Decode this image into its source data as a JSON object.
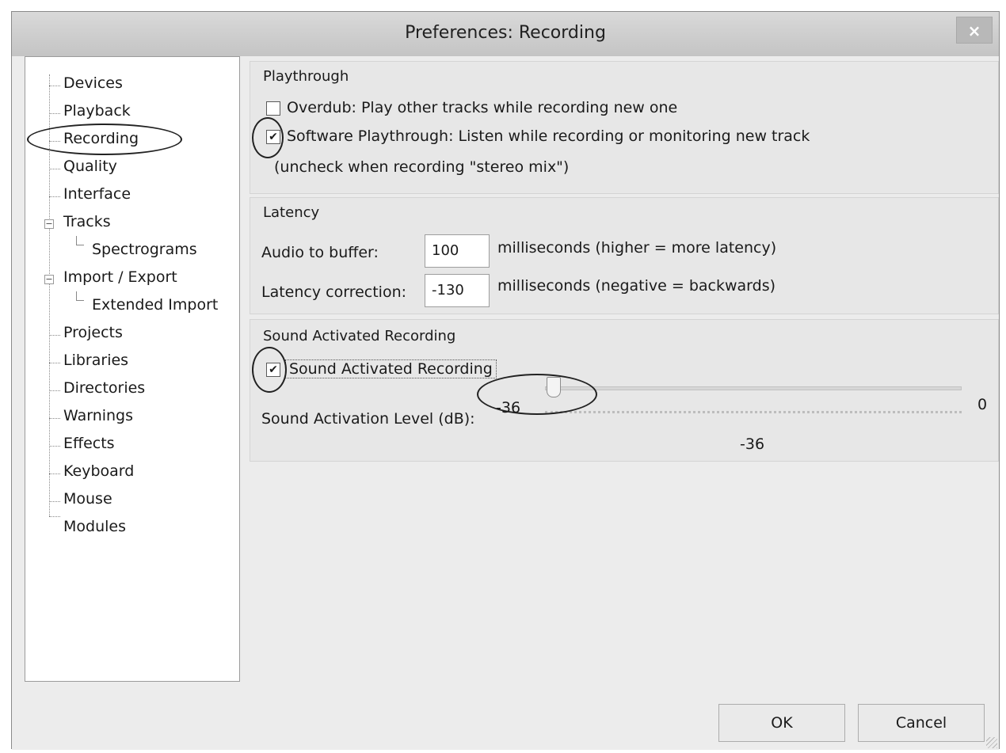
{
  "window": {
    "title": "Preferences: Recording",
    "close_glyph": "×"
  },
  "tree": {
    "items": [
      {
        "label": "Devices"
      },
      {
        "label": "Playback"
      },
      {
        "label": "Recording",
        "selected": true
      },
      {
        "label": "Quality"
      },
      {
        "label": "Interface"
      },
      {
        "label": "Tracks",
        "expandable": true
      },
      {
        "label": "Spectrograms",
        "child": true
      },
      {
        "label": "Import / Export",
        "expandable": true
      },
      {
        "label": "Extended Import",
        "child": true
      },
      {
        "label": "Projects"
      },
      {
        "label": "Libraries"
      },
      {
        "label": "Directories"
      },
      {
        "label": "Warnings"
      },
      {
        "label": "Effects"
      },
      {
        "label": "Keyboard"
      },
      {
        "label": "Mouse"
      },
      {
        "label": "Modules"
      }
    ]
  },
  "playthrough": {
    "title": "Playthrough",
    "overdub": {
      "label": "Overdub: Play other tracks while recording new one",
      "checked": false
    },
    "software": {
      "label": "Software Playthrough: Listen while recording or monitoring new track",
      "checked": true
    },
    "note": "(uncheck when recording \"stereo mix\")"
  },
  "latency": {
    "title": "Latency",
    "buffer": {
      "label": "Audio to buffer:",
      "value": "100",
      "unit": "milliseconds (higher = more latency)"
    },
    "correction": {
      "label": "Latency correction:",
      "value": "-130",
      "unit": "milliseconds (negative = backwards)"
    }
  },
  "sound_activated": {
    "title": "Sound Activated Recording",
    "checkbox": {
      "label": "Sound Activated Recording",
      "checked": true
    },
    "level_label": "Sound Activation Level (dB):",
    "min_label": "-36",
    "max_label": "0",
    "value_readout": "-36",
    "slider_value": -36,
    "slider_min": -60,
    "slider_max": 0
  },
  "buttons": {
    "ok": "OK",
    "cancel": "Cancel"
  },
  "check_glyph": "✔"
}
